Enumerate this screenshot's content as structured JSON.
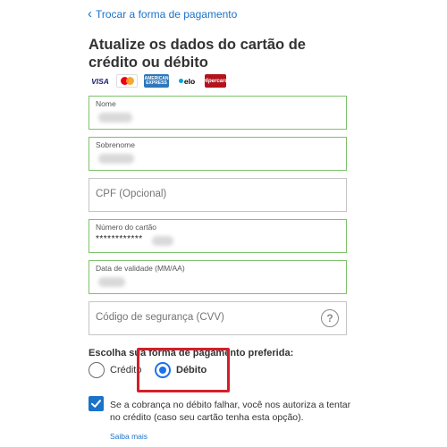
{
  "back_link": {
    "label": "Trocar a forma de pagamento"
  },
  "title": "Atualize os dados do cartão de crédito ou débito",
  "card_logos": [
    {
      "name": "visa",
      "label": "VISA"
    },
    {
      "name": "mastercard",
      "label": ""
    },
    {
      "name": "amex",
      "label": "AMERICAN EXPRESS"
    },
    {
      "name": "elo",
      "label": "elo"
    },
    {
      "name": "hipercard",
      "label": "Hipercard"
    }
  ],
  "fields": {
    "nome": {
      "label": "Nome",
      "value": ""
    },
    "sobrenome": {
      "label": "Sobrenome",
      "value": ""
    },
    "cpf": {
      "placeholder": "CPF (Opcional)"
    },
    "numero": {
      "label": "Número do cartão",
      "value": "************"
    },
    "validade": {
      "label": "Data de validade (MM/AA)",
      "value": ""
    },
    "cvv": {
      "placeholder": "Código de segurança (CVV)",
      "help": "?"
    }
  },
  "payment": {
    "label": "Escolha sua forma de pagamento preferida:",
    "options": [
      {
        "label": "Crédito",
        "selected": false
      },
      {
        "label": "Débito",
        "selected": true
      }
    ]
  },
  "consent": {
    "checked": true,
    "text": "Se a cobrança no débito falhar, você nos autoriza a tentar no crédito (caso seu cartão tenha esta opção).",
    "link": "Saiba mais"
  },
  "colors": {
    "accent": "#1a73c8",
    "valid_border": "#7cc26a",
    "highlight": "#d21f2a"
  }
}
